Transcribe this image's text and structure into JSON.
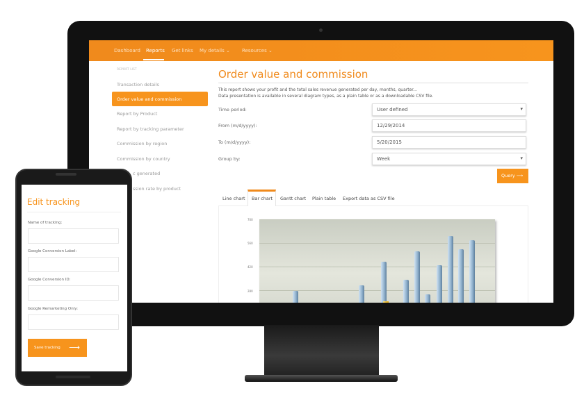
{
  "desktop": {
    "nav": [
      {
        "label": "Dashboard"
      },
      {
        "label": "Reports",
        "active": true
      },
      {
        "label": "Get links"
      },
      {
        "label": "My details",
        "dropdown": true
      },
      {
        "label": "Resources",
        "dropdown": true
      }
    ],
    "sidebar": {
      "heading": "REPORT LIST",
      "items": [
        {
          "label": "Transaction details"
        },
        {
          "label": "Order value and commission",
          "active": true
        },
        {
          "label": "Report by Product"
        },
        {
          "label": "Report by tracking parameter"
        },
        {
          "label": "Commission by region"
        },
        {
          "label": "Commission by country"
        },
        {
          "label": "c generated"
        },
        {
          "label": "ssion rate by product"
        }
      ]
    },
    "title": "Order value and commission",
    "description": [
      "This report shows your profit and the total sales revenue generated per day, months, quarter...",
      "Data presentation is available in several diagram types, as a plain table or as a downloadable CSV file."
    ],
    "form": {
      "time_period": {
        "label": "Time period:",
        "value": "User defined"
      },
      "from": {
        "label": "From (m/d/yyyy):",
        "value": "12/29/2014"
      },
      "to": {
        "label": "To (m/d/yyyy):",
        "value": "5/20/2015"
      },
      "group_by": {
        "label": "Group by:",
        "value": "Week"
      },
      "query_label": "Query"
    },
    "tabs": [
      {
        "label": "Line chart"
      },
      {
        "label": "Bar chart",
        "active": true
      },
      {
        "label": "Gantt chart"
      },
      {
        "label": "Plain table"
      },
      {
        "label": "Export data as CSV file"
      }
    ],
    "accent": "#f7941d"
  },
  "chart_data": {
    "type": "bar",
    "ylim": [
      0,
      700
    ],
    "yticks": [
      "700",
      "560",
      "420",
      "280"
    ],
    "series": [
      {
        "values": [
          275,
          310,
          450,
          340,
          510,
          255,
          430,
          600,
          525,
          575
        ]
      },
      {
        "values": [
          200,
          215
        ]
      }
    ],
    "grid": true
  },
  "phone": {
    "title": "Edit tracking",
    "fields": [
      {
        "label": "Name of tracking:",
        "value": ""
      },
      {
        "label": "Google Conversion Label:",
        "value": ""
      },
      {
        "label": "Google Conversion ID:",
        "value": ""
      },
      {
        "label": "Google Remarketing Only:",
        "value": ""
      }
    ],
    "save_label": "Save tracking"
  }
}
